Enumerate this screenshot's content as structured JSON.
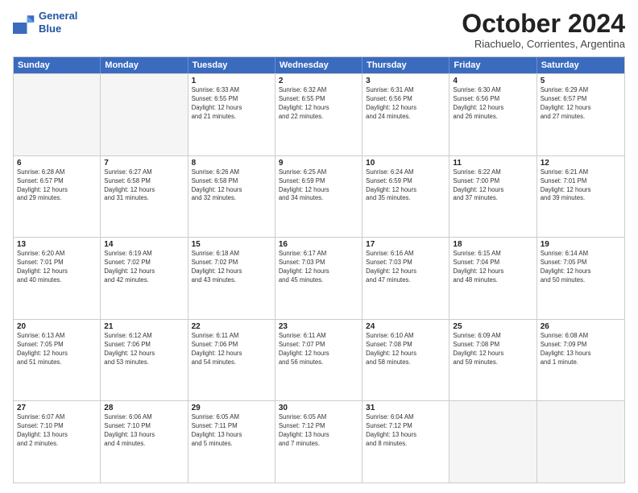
{
  "header": {
    "logo_line1": "General",
    "logo_line2": "Blue",
    "month_title": "October 2024",
    "subtitle": "Riachuelo, Corrientes, Argentina"
  },
  "days": [
    "Sunday",
    "Monday",
    "Tuesday",
    "Wednesday",
    "Thursday",
    "Friday",
    "Saturday"
  ],
  "rows": [
    [
      {
        "date": "",
        "info": ""
      },
      {
        "date": "",
        "info": ""
      },
      {
        "date": "1",
        "info": "Sunrise: 6:33 AM\nSunset: 6:55 PM\nDaylight: 12 hours\nand 21 minutes."
      },
      {
        "date": "2",
        "info": "Sunrise: 6:32 AM\nSunset: 6:55 PM\nDaylight: 12 hours\nand 22 minutes."
      },
      {
        "date": "3",
        "info": "Sunrise: 6:31 AM\nSunset: 6:56 PM\nDaylight: 12 hours\nand 24 minutes."
      },
      {
        "date": "4",
        "info": "Sunrise: 6:30 AM\nSunset: 6:56 PM\nDaylight: 12 hours\nand 26 minutes."
      },
      {
        "date": "5",
        "info": "Sunrise: 6:29 AM\nSunset: 6:57 PM\nDaylight: 12 hours\nand 27 minutes."
      }
    ],
    [
      {
        "date": "6",
        "info": "Sunrise: 6:28 AM\nSunset: 6:57 PM\nDaylight: 12 hours\nand 29 minutes."
      },
      {
        "date": "7",
        "info": "Sunrise: 6:27 AM\nSunset: 6:58 PM\nDaylight: 12 hours\nand 31 minutes."
      },
      {
        "date": "8",
        "info": "Sunrise: 6:26 AM\nSunset: 6:58 PM\nDaylight: 12 hours\nand 32 minutes."
      },
      {
        "date": "9",
        "info": "Sunrise: 6:25 AM\nSunset: 6:59 PM\nDaylight: 12 hours\nand 34 minutes."
      },
      {
        "date": "10",
        "info": "Sunrise: 6:24 AM\nSunset: 6:59 PM\nDaylight: 12 hours\nand 35 minutes."
      },
      {
        "date": "11",
        "info": "Sunrise: 6:22 AM\nSunset: 7:00 PM\nDaylight: 12 hours\nand 37 minutes."
      },
      {
        "date": "12",
        "info": "Sunrise: 6:21 AM\nSunset: 7:01 PM\nDaylight: 12 hours\nand 39 minutes."
      }
    ],
    [
      {
        "date": "13",
        "info": "Sunrise: 6:20 AM\nSunset: 7:01 PM\nDaylight: 12 hours\nand 40 minutes."
      },
      {
        "date": "14",
        "info": "Sunrise: 6:19 AM\nSunset: 7:02 PM\nDaylight: 12 hours\nand 42 minutes."
      },
      {
        "date": "15",
        "info": "Sunrise: 6:18 AM\nSunset: 7:02 PM\nDaylight: 12 hours\nand 43 minutes."
      },
      {
        "date": "16",
        "info": "Sunrise: 6:17 AM\nSunset: 7:03 PM\nDaylight: 12 hours\nand 45 minutes."
      },
      {
        "date": "17",
        "info": "Sunrise: 6:16 AM\nSunset: 7:03 PM\nDaylight: 12 hours\nand 47 minutes."
      },
      {
        "date": "18",
        "info": "Sunrise: 6:15 AM\nSunset: 7:04 PM\nDaylight: 12 hours\nand 48 minutes."
      },
      {
        "date": "19",
        "info": "Sunrise: 6:14 AM\nSunset: 7:05 PM\nDaylight: 12 hours\nand 50 minutes."
      }
    ],
    [
      {
        "date": "20",
        "info": "Sunrise: 6:13 AM\nSunset: 7:05 PM\nDaylight: 12 hours\nand 51 minutes."
      },
      {
        "date": "21",
        "info": "Sunrise: 6:12 AM\nSunset: 7:06 PM\nDaylight: 12 hours\nand 53 minutes."
      },
      {
        "date": "22",
        "info": "Sunrise: 6:11 AM\nSunset: 7:06 PM\nDaylight: 12 hours\nand 54 minutes."
      },
      {
        "date": "23",
        "info": "Sunrise: 6:11 AM\nSunset: 7:07 PM\nDaylight: 12 hours\nand 56 minutes."
      },
      {
        "date": "24",
        "info": "Sunrise: 6:10 AM\nSunset: 7:08 PM\nDaylight: 12 hours\nand 58 minutes."
      },
      {
        "date": "25",
        "info": "Sunrise: 6:09 AM\nSunset: 7:08 PM\nDaylight: 12 hours\nand 59 minutes."
      },
      {
        "date": "26",
        "info": "Sunrise: 6:08 AM\nSunset: 7:09 PM\nDaylight: 13 hours\nand 1 minute."
      }
    ],
    [
      {
        "date": "27",
        "info": "Sunrise: 6:07 AM\nSunset: 7:10 PM\nDaylight: 13 hours\nand 2 minutes."
      },
      {
        "date": "28",
        "info": "Sunrise: 6:06 AM\nSunset: 7:10 PM\nDaylight: 13 hours\nand 4 minutes."
      },
      {
        "date": "29",
        "info": "Sunrise: 6:05 AM\nSunset: 7:11 PM\nDaylight: 13 hours\nand 5 minutes."
      },
      {
        "date": "30",
        "info": "Sunrise: 6:05 AM\nSunset: 7:12 PM\nDaylight: 13 hours\nand 7 minutes."
      },
      {
        "date": "31",
        "info": "Sunrise: 6:04 AM\nSunset: 7:12 PM\nDaylight: 13 hours\nand 8 minutes."
      },
      {
        "date": "",
        "info": ""
      },
      {
        "date": "",
        "info": ""
      }
    ]
  ]
}
